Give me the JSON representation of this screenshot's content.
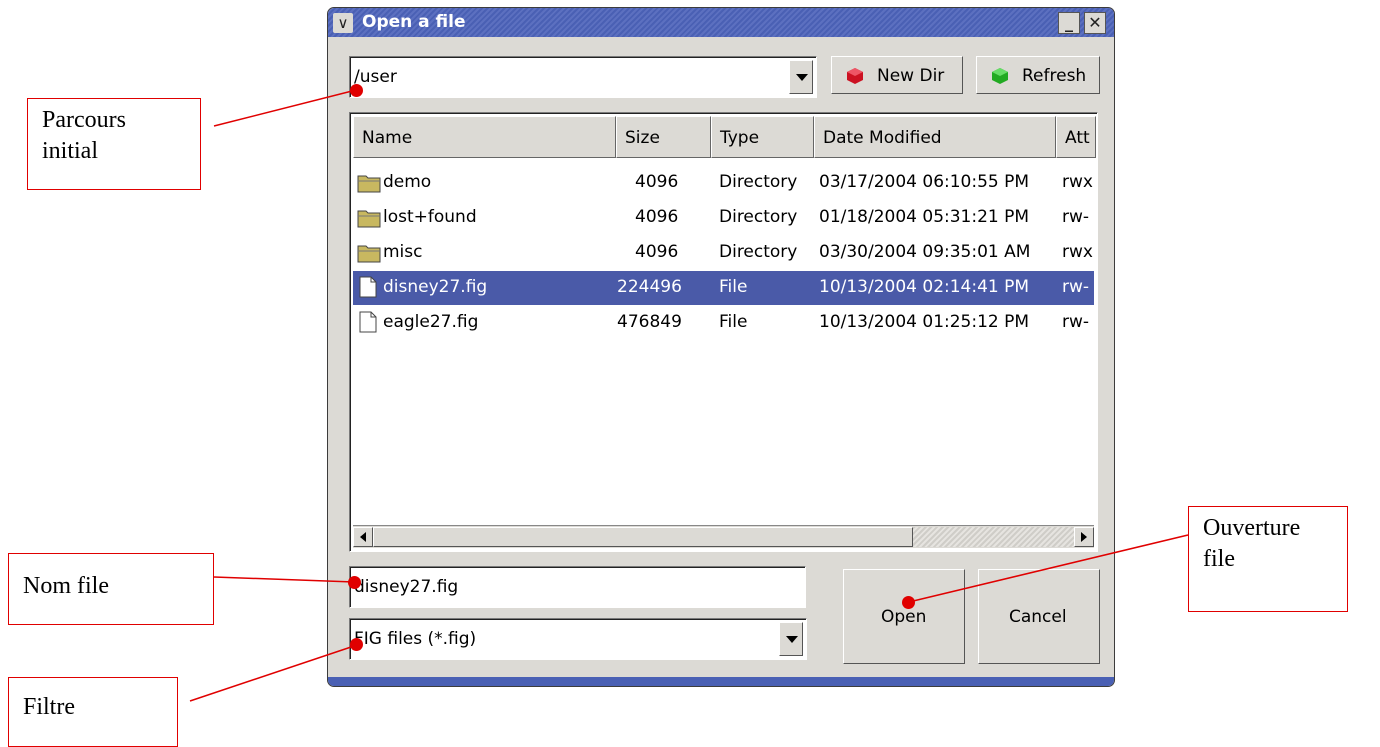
{
  "dialog": {
    "title": "Open a file",
    "path_value": "/user",
    "new_dir_label": "New Dir",
    "refresh_label": "Refresh",
    "columns": [
      "Name",
      "Size",
      "Type",
      "Date Modified",
      "Att"
    ],
    "files": [
      {
        "name": "demo",
        "size": "4096",
        "type": "Directory",
        "date": "03/17/2004 06:10:55 PM",
        "attr": "rwx",
        "kind": "folder",
        "selected": false
      },
      {
        "name": "lost+found",
        "size": "4096",
        "type": "Directory",
        "date": "01/18/2004 05:31:21 PM",
        "attr": "rw-",
        "kind": "folder",
        "selected": false
      },
      {
        "name": "misc",
        "size": "4096",
        "type": "Directory",
        "date": "03/30/2004 09:35:01 AM",
        "attr": "rwx",
        "kind": "folder",
        "selected": false
      },
      {
        "name": "disney27.fig",
        "size": "224496",
        "type": "File",
        "date": "10/13/2004 02:14:41 PM",
        "attr": "rw-",
        "kind": "file",
        "selected": true
      },
      {
        "name": "eagle27.fig",
        "size": "476849",
        "type": "File",
        "date": "10/13/2004 01:25:12 PM",
        "attr": "rw-",
        "kind": "file",
        "selected": false
      }
    ],
    "filename_value": "disney27.fig",
    "filter_value": "FIG files (*.fig)",
    "open_label": "Open",
    "cancel_label": "Cancel"
  },
  "annotations": {
    "initial_path": "Parcours initial",
    "file_name": "Nom file",
    "filter": "Filtre",
    "open_file": "Ouverture file"
  },
  "colors": {
    "titlebar": "#4a60b4",
    "selection": "#4a5aa8",
    "annotation_red": "#e00000",
    "new_dir_icon": "#cc1122",
    "refresh_icon": "#22aa22"
  }
}
